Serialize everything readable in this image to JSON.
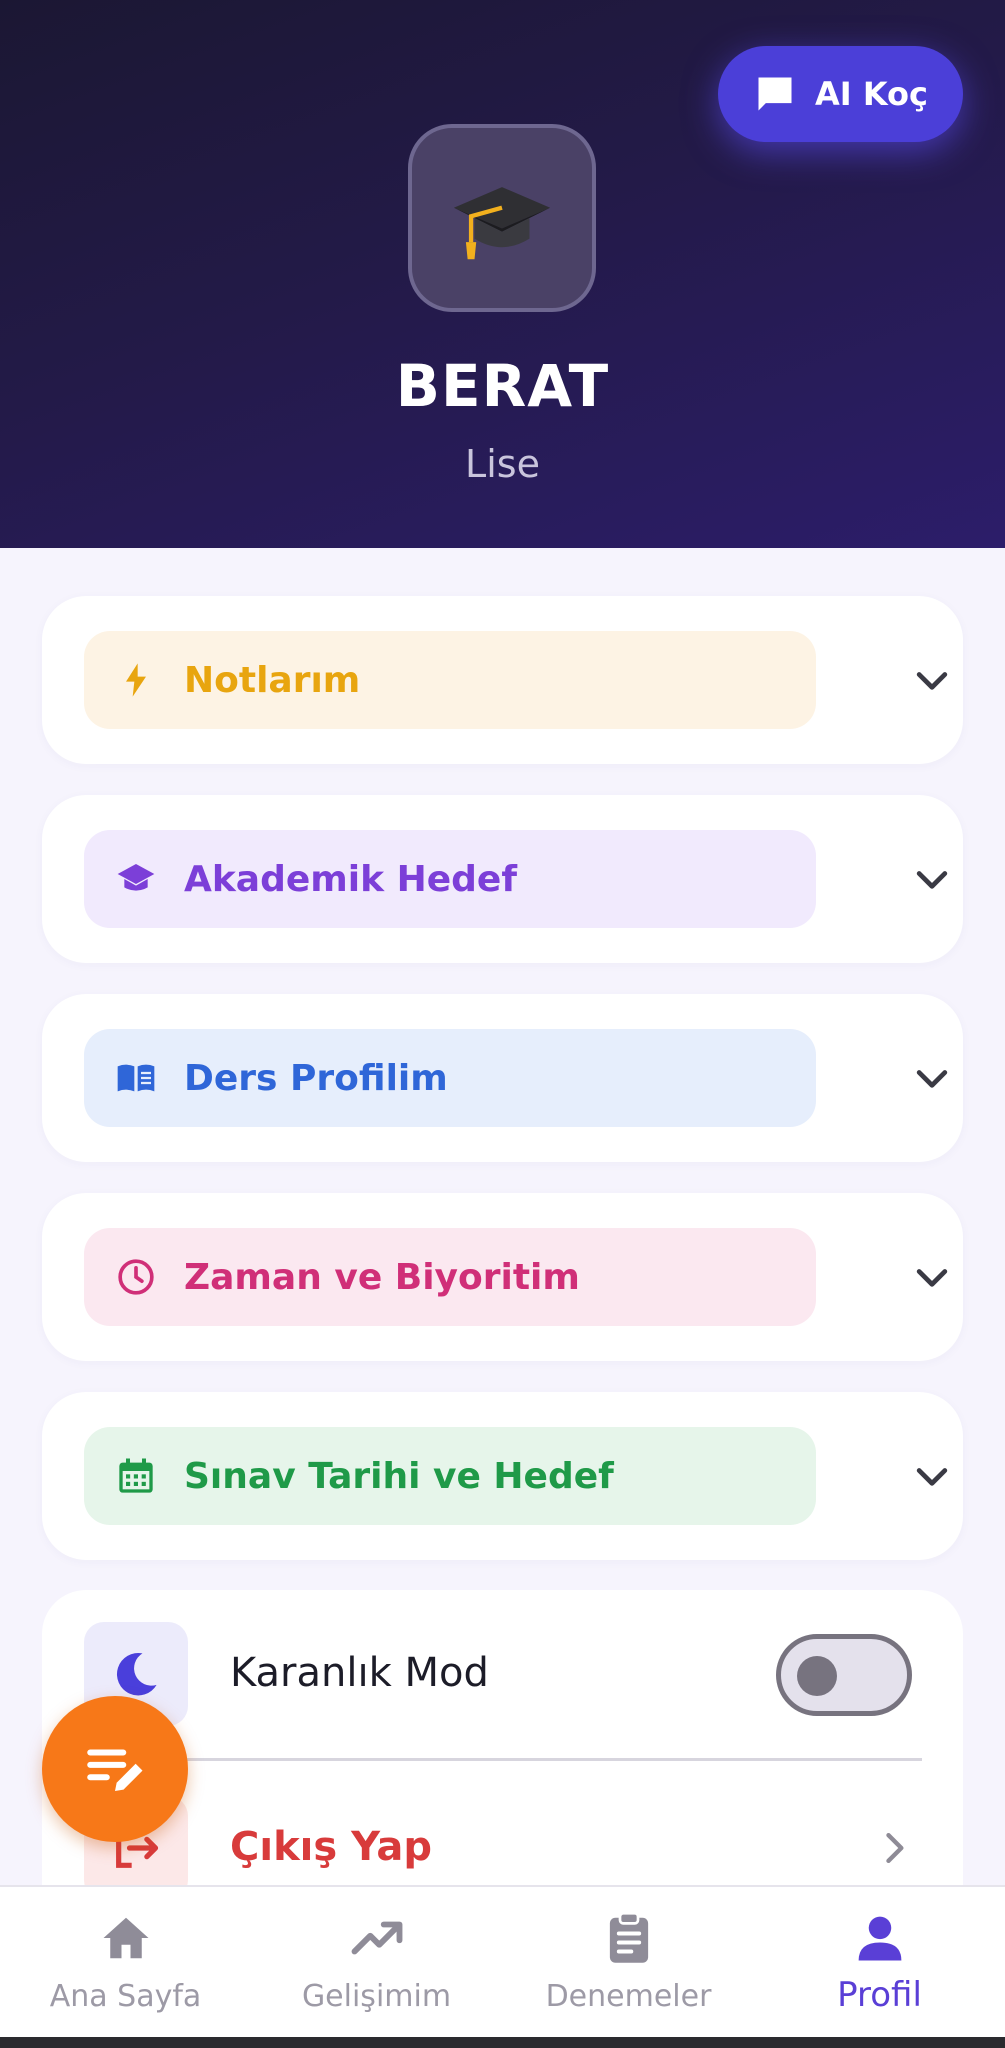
{
  "header": {
    "ai_button_label": "AI Koç",
    "user_name": "BERAT",
    "user_level": "Lise"
  },
  "sections": [
    {
      "label": "Notlarım",
      "icon": "bolt-icon",
      "color": "#e8a50f"
    },
    {
      "label": "Akademik Hedef",
      "icon": "graduation-cap-icon",
      "color": "#7c3fd8"
    },
    {
      "label": "Ders Profilim",
      "icon": "book-icon",
      "color": "#2f66d8"
    },
    {
      "label": "Zaman ve Biyoritim",
      "icon": "clock-icon",
      "color": "#d02f78"
    },
    {
      "label": "Sınav Tarihi ve Hedef",
      "icon": "calendar-icon",
      "color": "#1f9a48"
    }
  ],
  "settings": {
    "dark_mode_label": "Karanlık Mod",
    "dark_mode_enabled": false,
    "logout_label": "Çıkış Yap"
  },
  "bottom_nav": {
    "items": [
      {
        "label": "Ana Sayfa",
        "icon": "home-icon",
        "active": false
      },
      {
        "label": "Gelişimim",
        "icon": "trending-up-icon",
        "active": false
      },
      {
        "label": "Denemeler",
        "icon": "clipboard-icon",
        "active": false
      },
      {
        "label": "Profil",
        "icon": "person-icon",
        "active": true
      }
    ]
  },
  "colors": {
    "accent": "#5a3fd6",
    "fab": "#f77818",
    "danger": "#d83b3b"
  }
}
